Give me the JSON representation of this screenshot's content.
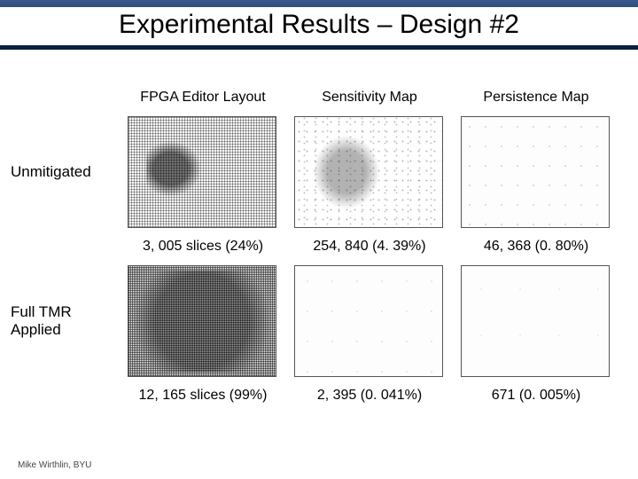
{
  "title": "Experimental Results – Design #2",
  "columns": {
    "c1": "FPGA Editor Layout",
    "c2": "Sensitivity Map",
    "c3": "Persistence Map"
  },
  "rows": {
    "r1_label": "Unmitigated",
    "r2_label": "Full TMR\nApplied"
  },
  "captions": {
    "r1c1": "3, 005 slices (24%)",
    "r1c2": "254, 840 (4. 39%)",
    "r1c3": "46, 368 (0. 80%)",
    "r2c1": "12, 165 slices (99%)",
    "r2c2": "2, 395 (0. 041%)",
    "r2c3": "671 (0. 005%)"
  },
  "footer": "Mike Wirthlin, BYU"
}
